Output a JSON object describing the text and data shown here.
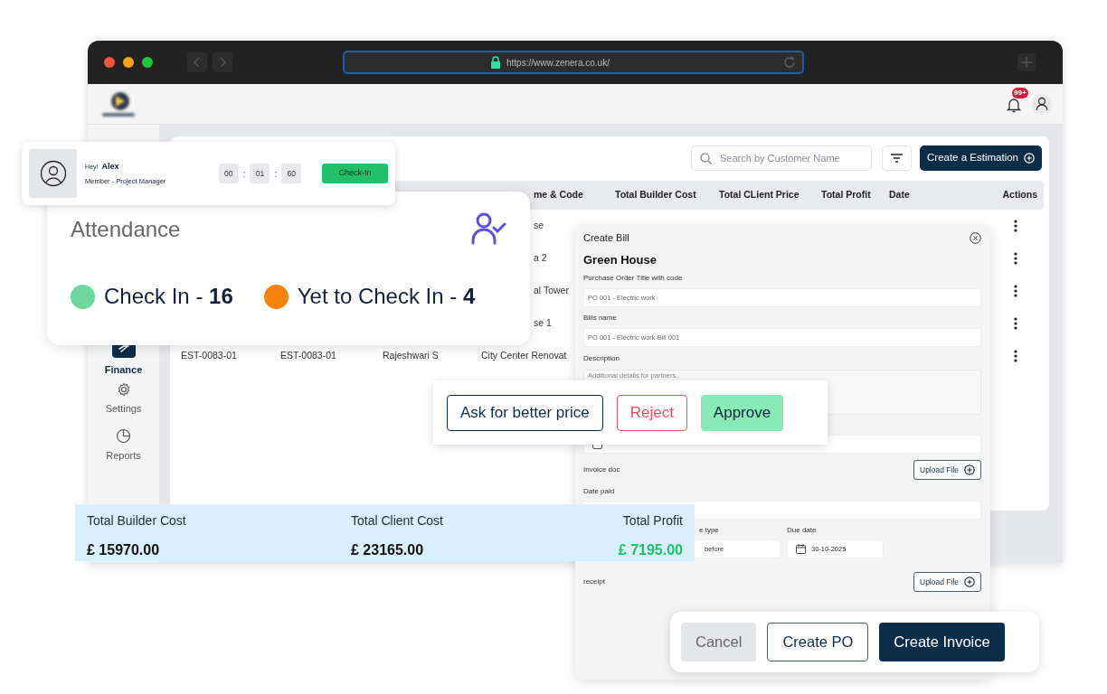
{
  "browser": {
    "url": "https://www.zenera.co.uk/"
  },
  "header": {
    "notification_count": "99+"
  },
  "sidebar": {
    "items": [
      {
        "label": "Finance",
        "selected": true
      },
      {
        "label": "Settings",
        "selected": false
      },
      {
        "label": "Reports",
        "selected": false
      }
    ]
  },
  "toolbar": {
    "search": {
      "placeholder": "Search by Customer Name"
    },
    "create_button": "Create a Estimation"
  },
  "table": {
    "columns": [
      "me & Code",
      "Total Builder Cost",
      "Total CLient Price",
      "Total Profit",
      "Date",
      "Actions"
    ],
    "rows": [
      {
        "name_and_code": "se"
      },
      {
        "name_and_code": "a 2"
      },
      {
        "name_and_code": "al Tower"
      },
      {
        "name_and_code": "se 1"
      },
      {
        "column_1": "EST-0083-01",
        "column_2": "EST-0083-01",
        "column_3": "Rajeshwari S",
        "name_and_code": "City Center Renovat"
      }
    ]
  },
  "checkin_card": {
    "greeting": "Hey!",
    "name": "Alex",
    "role": "Member - Project Manager",
    "timer": [
      "00",
      "01",
      "60"
    ],
    "timer_separators": [
      ":",
      ":"
    ],
    "button": "Check-In"
  },
  "attendance": {
    "title": "Attendance",
    "stats": [
      {
        "text": "Check In - **16**",
        "color": "#6dd89a"
      },
      {
        "text": "Yet to Check In - **4**",
        "color": "#f5820a"
      }
    ]
  },
  "create_bill": {
    "title": "Create Bill",
    "project": "Green House",
    "fields": [
      {
        "kind": "text",
        "label": "Purchase Order Title with code",
        "value": "PO 001 - Electric work"
      },
      {
        "kind": "text",
        "label": "Bills name",
        "value": "PO 001 - Electric work Bill 001"
      },
      {
        "kind": "textarea",
        "label": "Description",
        "placeholder": "Additional details for partners.."
      },
      {
        "kind": "checkbox",
        "checked": false
      },
      {
        "kind": "upload",
        "label": "Invoice doc",
        "button": "Upload File"
      },
      {
        "kind": "text",
        "label": "Date paid"
      },
      {
        "kind": "pair",
        "items": [
          {
            "kind": "text",
            "label": "e type",
            "value": "before"
          },
          {
            "kind": "date",
            "label": "Due date",
            "value": "30-10-2025"
          }
        ]
      },
      {
        "kind": "upload",
        "label": "receipt",
        "button": "Upload File"
      }
    ]
  },
  "price_actions": [
    {
      "label": "Ask for better price",
      "kind": "outline"
    },
    {
      "label": "Reject",
      "kind": "danger"
    },
    {
      "label": "Approve",
      "kind": "success"
    }
  ],
  "totals": [
    {
      "label": "Total Builder Cost",
      "value": "£ 15970.00",
      "kind": "cost"
    },
    {
      "label": "Total Client Cost",
      "value": "£ 23165.00",
      "kind": "cost"
    },
    {
      "label": "Total Profit",
      "value": "£ 7195.00",
      "kind": "profit"
    }
  ],
  "footer_actions": [
    {
      "label": "Cancel",
      "kind": "cancel"
    },
    {
      "label": "Create PO",
      "kind": "outline"
    },
    {
      "label": "Create Invoice",
      "kind": "primary"
    }
  ]
}
